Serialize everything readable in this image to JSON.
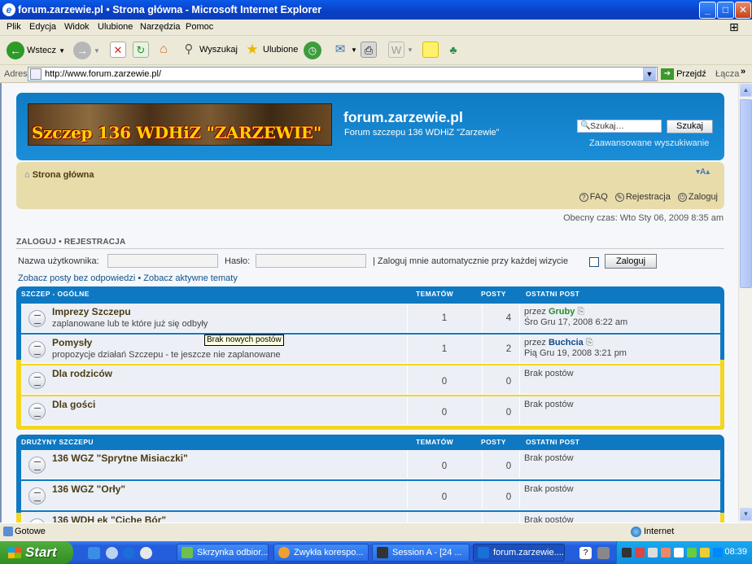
{
  "window": {
    "title": "forum.zarzewie.pl • Strona główna - Microsoft Internet Explorer",
    "buttons": {
      "minimize": "_",
      "maximize": "□",
      "close": "✕"
    }
  },
  "menu": [
    "Plik",
    "Edycja",
    "Widok",
    "Ulubione",
    "Narzędzia",
    "Pomoc"
  ],
  "toolbar": {
    "back_label": "Wstecz",
    "search_label": "Wyszukaj",
    "favorites_label": "Ulubione"
  },
  "address": {
    "label": "Adres",
    "url": "http://www.forum.zarzewie.pl/",
    "go_label": "Przejdź",
    "links_label": "Łącza"
  },
  "site": {
    "banner_text": "Szczep 136 WDHiZ \"ZARZEWIE\"",
    "name": "forum.zarzewie.pl",
    "description": "Forum szczepu 136 WDHiZ \"Zarzewie\"",
    "search_placeholder": "Szukaj…",
    "search_button": "Szukaj",
    "advanced_search": "Zaawansowane wyszukiwanie"
  },
  "nav": {
    "home": "Strona główna",
    "font_size": "A",
    "faq": "FAQ",
    "register": "Rejestracja",
    "login": "Zaloguj"
  },
  "current_time": "Obecny czas: Wto Sty 06, 2009 8:35 am",
  "login": {
    "header": "ZALOGUJ • REJESTRACJA",
    "username_label": "Nazwa użytkownika:",
    "password_label": "Hasło:",
    "remember_label": "| Zaloguj mnie automatycznie przy każdej wizycie",
    "button": "Zaloguj"
  },
  "quick_links": "Zobacz posty bez odpowiedzi • Zobacz aktywne tematy",
  "categories": [
    {
      "name": "SZCZEP - OGÓLNE",
      "col_topics": "TEMATÓW",
      "col_posts": "POSTY",
      "col_last": "OSTATNI POST",
      "forums": [
        {
          "title": "Imprezy Szczepu",
          "desc": "zaplanowane lub te które już się odbyły",
          "topics": "1",
          "posts": "4",
          "last_by_prefix": "przez",
          "last_by": "Gruby",
          "last_date": "Śro Gru 17, 2008 6:22 am"
        },
        {
          "title": "Pomysły",
          "desc": "propozycje działań Szczepu - te jeszcze nie zaplanowane",
          "topics": "1",
          "posts": "2",
          "last_by_prefix": "przez",
          "last_by": "Buchcia",
          "last_date": "Pią Gru 19, 2008 3:21 pm"
        },
        {
          "title": "Dla rodziców",
          "desc": "",
          "topics": "0",
          "posts": "0",
          "last_none": "Brak postów"
        },
        {
          "title": "Dla gości",
          "desc": "",
          "topics": "0",
          "posts": "0",
          "last_none": "Brak postów"
        }
      ]
    },
    {
      "name": "DRUŻYNY SZCZEPU",
      "col_topics": "TEMATÓW",
      "col_posts": "POSTY",
      "col_last": "OSTATNI POST",
      "forums": [
        {
          "title": "136 WGZ \"Sprytne Misiaczki\"",
          "topics": "0",
          "posts": "0",
          "last_none": "Brak postów"
        },
        {
          "title": "136 WGZ \"Orły\"",
          "topics": "0",
          "posts": "0",
          "last_none": "Brak postów"
        },
        {
          "title": "136 WDH ek \"Ciche Bór\"",
          "topics": "",
          "posts": "",
          "last_none": "Brak postów"
        }
      ]
    }
  ],
  "tooltip": "Brak nowych postów",
  "status": {
    "text": "Gotowe",
    "zone": "Internet"
  },
  "taskbar": {
    "start": "Start",
    "tasks": [
      "Skrzynka odbior...",
      "Zwykła korespo...",
      "Session A - [24 ...",
      "forum.zarzewie...."
    ],
    "clock": "08:39"
  },
  "colors": {
    "header_blue": "#0f7bc4",
    "nav_tan": "#e9dcab",
    "row_bg": "#ecf0f6",
    "category_bar": "#f5d61e"
  }
}
